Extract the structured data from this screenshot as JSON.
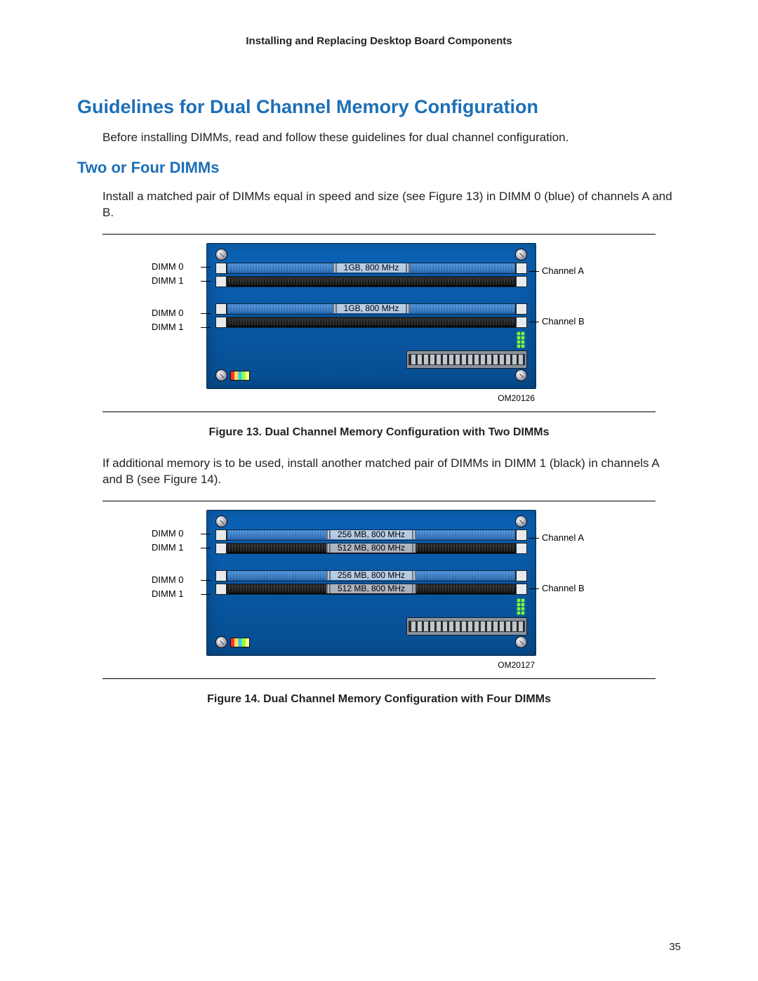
{
  "header": "Installing and Replacing Desktop Board Components",
  "title": "Guidelines for Dual Channel Memory Configuration",
  "intro": "Before installing DIMMs, read and follow these guidelines for dual channel configuration.",
  "section_heading": "Two or Four DIMMs",
  "para1": "Install a matched pair of DIMMs equal in speed and size (see Figure 13) in DIMM 0 (blue) of channels A and B.",
  "para2": "If additional memory is to be used, install another matched pair of DIMMs in DIMM 1 (black) in channels A and B (see Figure 14).",
  "fig13": {
    "caption": "Figure 13.  Dual Channel Memory Configuration with Two DIMMs",
    "om": "OM20126",
    "left_labels": [
      "DIMM 0",
      "DIMM 1",
      "DIMM 0",
      "DIMM 1"
    ],
    "right_labels": [
      "Channel A",
      "Channel B"
    ],
    "slots": [
      {
        "color": "blue",
        "text": "1GB, 800 MHz"
      },
      {
        "color": "black",
        "text": ""
      },
      {
        "color": "blue",
        "text": "1GB, 800 MHz"
      },
      {
        "color": "black",
        "text": ""
      }
    ]
  },
  "fig14": {
    "caption": "Figure 14.  Dual Channel Memory Configuration with Four DIMMs",
    "om": "OM20127",
    "left_labels": [
      "DIMM 0",
      "DIMM 1",
      "DIMM 0",
      "DIMM 1"
    ],
    "right_labels": [
      "Channel A",
      "Channel B"
    ],
    "slots": [
      {
        "color": "blue",
        "text": "256 MB, 800 MHz"
      },
      {
        "color": "black",
        "text": "512 MB, 800 MHz"
      },
      {
        "color": "blue",
        "text": "256 MB, 800 MHz"
      },
      {
        "color": "black",
        "text": "512 MB, 800 MHz"
      }
    ]
  },
  "page_number": "35"
}
